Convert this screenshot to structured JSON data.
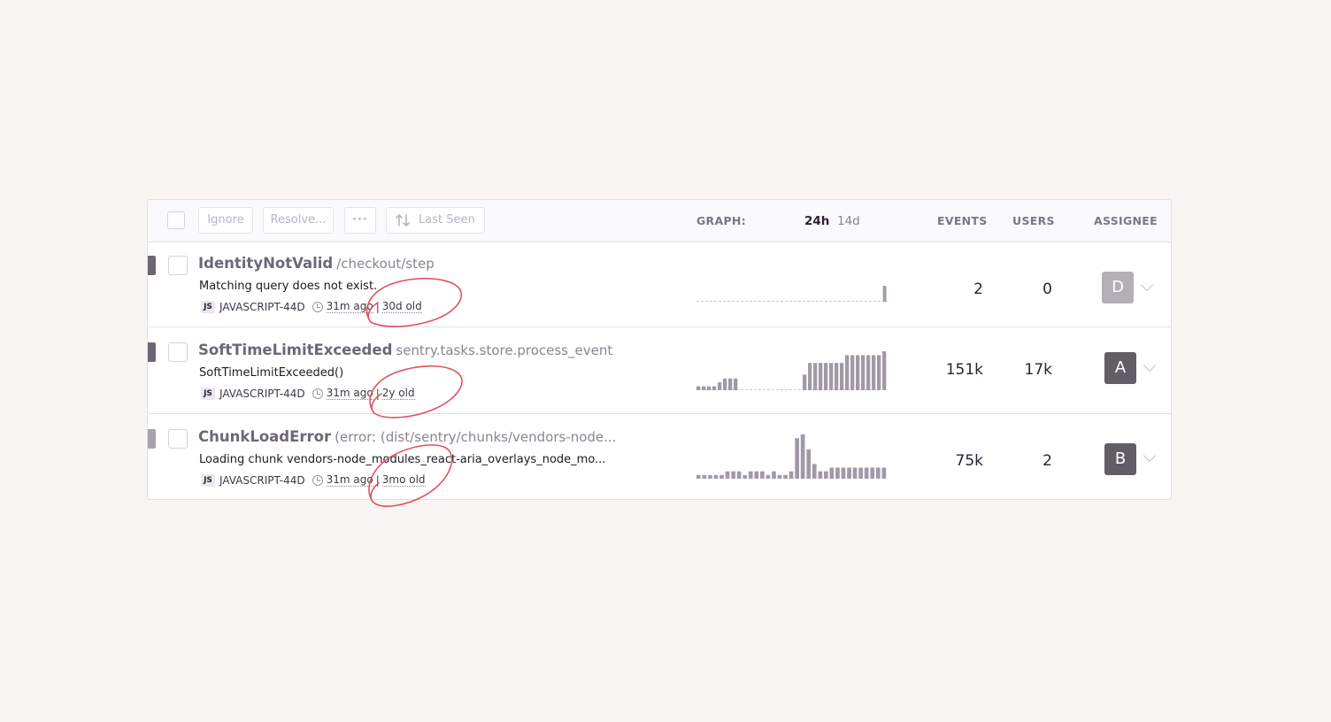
{
  "toolbar": {
    "ignore_label": "Ignore",
    "resolve_label": "Resolve...",
    "more_label": "···",
    "sort_label": "Last Seen",
    "graph_label": "GRAPH:",
    "period_24h": "24h",
    "period_14d": "14d",
    "events_header": "EVENTS",
    "users_header": "USERS",
    "assignee_header": "ASSIGNEE"
  },
  "colors": {
    "annotation": "#e0525d",
    "bar": "#a19aa6",
    "avatar_dark": "#625d66",
    "avatar_light": "#b4aeb8"
  },
  "issues": [
    {
      "name": "IdentityNotValid",
      "location": "/checkout/step",
      "message": "Matching query does not exist.",
      "platform": "JS",
      "short_id": "JAVASCRIPT-44D",
      "last_seen": "31m ago",
      "age": "30d old",
      "events": "2",
      "users": "0",
      "assignee": "D",
      "graph": [
        0,
        0,
        0,
        0,
        0,
        0,
        0,
        0,
        0,
        0,
        0,
        0,
        0,
        0,
        0,
        0,
        0,
        0,
        0,
        0,
        0,
        0,
        0,
        0,
        0,
        0,
        0,
        0,
        0,
        0,
        0,
        0,
        0,
        0,
        0,
        0,
        0,
        0,
        0,
        0,
        2
      ]
    },
    {
      "name": "SoftTimeLimitExceeded",
      "location": "sentry.tasks.store.process_event",
      "message": "SoftTimeLimitExceeded()",
      "platform": "JS",
      "short_id": "JAVASCRIPT-44D",
      "last_seen": "31m ago",
      "age": "2y old",
      "events": "151k",
      "users": "17k",
      "assignee": "A",
      "graph": [
        1,
        1,
        1,
        1,
        2,
        3,
        3,
        3,
        0,
        0,
        0,
        0,
        0,
        0,
        0,
        0,
        0,
        0,
        0,
        0,
        4,
        7,
        7,
        7,
        7,
        7,
        7,
        7,
        9,
        9,
        9,
        9,
        9,
        9,
        9,
        10
      ]
    },
    {
      "name": "ChunkLoadError",
      "location": "(error: (dist/sentry/chunks/vendors-node...",
      "message": "Loading chunk vendors-node_modules_react-aria_overlays_node_mo...",
      "platform": "JS",
      "short_id": "JAVASCRIPT-44D",
      "last_seen": "31m ago",
      "age": "3mo old",
      "events": "75k",
      "users": "2",
      "assignee": "B",
      "graph": [
        1,
        1,
        1,
        1,
        1,
        2,
        2,
        2,
        1,
        2,
        2,
        2,
        1,
        2,
        1,
        1,
        2,
        11,
        12,
        8,
        4,
        2,
        2,
        3,
        3,
        3,
        3,
        3,
        3,
        3,
        3,
        3,
        3
      ]
    }
  ]
}
